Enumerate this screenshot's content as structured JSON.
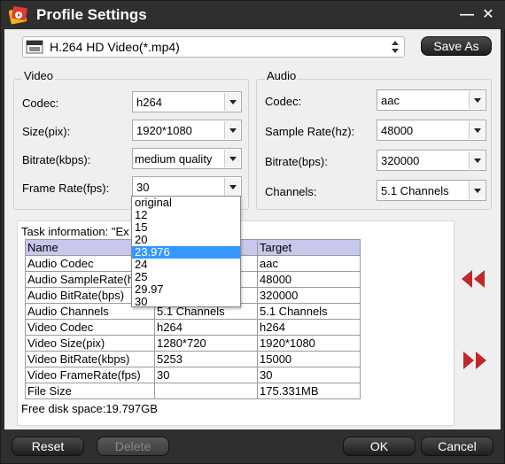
{
  "window": {
    "title": "Profile Settings"
  },
  "format": {
    "selected": "H.264 HD Video(*.mp4)",
    "icon": "hd-video-format-icon"
  },
  "save_as_label": "Save As",
  "video": {
    "group_title": "Video",
    "codec_label": "Codec:",
    "codec_value": "h264",
    "size_label": "Size(pix):",
    "size_value": "1920*1080",
    "bitrate_label": "Bitrate(kbps):",
    "bitrate_value": "medium quality",
    "framerate_label": "Frame Rate(fps):",
    "framerate_value": "30"
  },
  "audio": {
    "group_title": "Audio",
    "codec_label": "Codec:",
    "codec_value": "aac",
    "samplerate_label": "Sample Rate(hz):",
    "samplerate_value": "48000",
    "bitrate_label": "Bitrate(bps):",
    "bitrate_value": "320000",
    "channels_label": "Channels:",
    "channels_value": "5.1 Channels"
  },
  "framerate_dropdown": {
    "options": [
      "original",
      "12",
      "15",
      "20",
      "23.976",
      "24",
      "25",
      "29.97",
      "30"
    ],
    "highlighted": "23.976"
  },
  "task": {
    "info_label": "Task information: \"Ex",
    "headers": [
      "Name",
      "Source",
      "Target"
    ],
    "rows": [
      [
        "Audio Codec",
        "",
        "aac"
      ],
      [
        "Audio SampleRate(hz)",
        "",
        "48000"
      ],
      [
        "Audio BitRate(bps)",
        "",
        "320000"
      ],
      [
        "Audio Channels",
        "5.1 Channels",
        "5.1 Channels"
      ],
      [
        "Video Codec",
        "h264",
        "h264"
      ],
      [
        "Video Size(pix)",
        "1280*720",
        "1920*1080"
      ],
      [
        "Video BitRate(kbps)",
        "5253",
        "15000"
      ],
      [
        "Video FrameRate(fps)",
        "30",
        "30"
      ],
      [
        "File Size",
        "",
        "175.331MB"
      ]
    ],
    "free_space": "Free disk space:19.797GB"
  },
  "buttons": {
    "reset": "Reset",
    "delete": "Delete",
    "ok": "OK",
    "cancel": "Cancel"
  },
  "colors": {
    "selection": "#3399ff",
    "arrow_red": "#c0282a",
    "header_bg": "#c8c8ec"
  }
}
